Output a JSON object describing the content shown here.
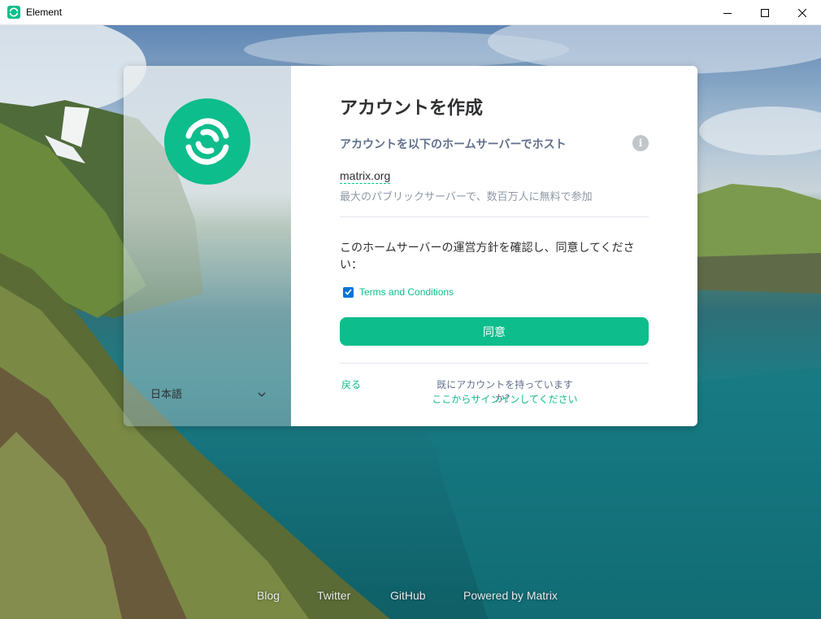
{
  "window": {
    "title": "Element",
    "controls": [
      "minimize-icon",
      "maximize-icon",
      "close-icon"
    ]
  },
  "sidebar": {
    "language": "日本語"
  },
  "form": {
    "heading": "アカウントを作成",
    "host_label": "アカウントを以下のホームサーバーでホスト",
    "server_name": "matrix.org",
    "server_description": "最大のパブリックサーバーで、数百万人に無料で参加",
    "policy_text": "このホームサーバーの運営方針を確認し、同意してください：",
    "terms_label": "Terms and Conditions",
    "terms_checked": true,
    "agree_button": "同意",
    "back_link": "戻る",
    "have_account": "既にアカウントを持っていますか？",
    "signin_link": "ここからサインインしてください"
  },
  "footer": {
    "links": [
      "Blog",
      "Twitter",
      "GitHub",
      "Powered by Matrix"
    ]
  },
  "colors": {
    "accent": "#0dbd8b",
    "text_primary": "#2e2f32",
    "text_secondary": "#61708b",
    "text_muted": "#8d99a5"
  }
}
